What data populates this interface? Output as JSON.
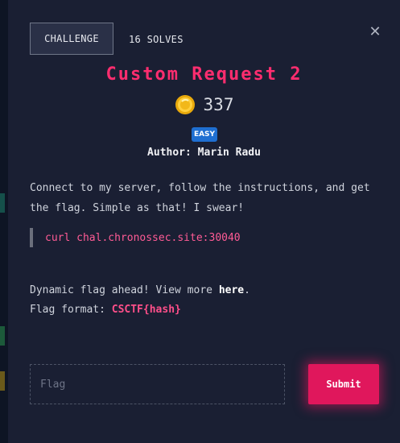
{
  "modal": {
    "tab_label": "CHALLENGE",
    "solves_label": "16 SOLVES",
    "close_icon": "close-icon",
    "title": "Custom Request 2",
    "points": "337",
    "difficulty": "EASY",
    "author": "Author: Marin Radu",
    "description": "Connect to my server, follow the instructions, and get the flag. Simple as that! I swear!",
    "command": "curl chal.chronossec.site:30040",
    "dynamic_prefix": "Dynamic flag ahead! View more ",
    "dynamic_link": "here",
    "dynamic_suffix": ".",
    "flag_format_label": "Flag format: ",
    "flag_format_value": "CSCTF{hash}",
    "flag_placeholder": "Flag",
    "submit_label": "Submit"
  },
  "colors": {
    "accent": "#ff2d6f",
    "button": "#e0175c",
    "badge": "#1f6fd1",
    "background": "#1a1f33"
  }
}
